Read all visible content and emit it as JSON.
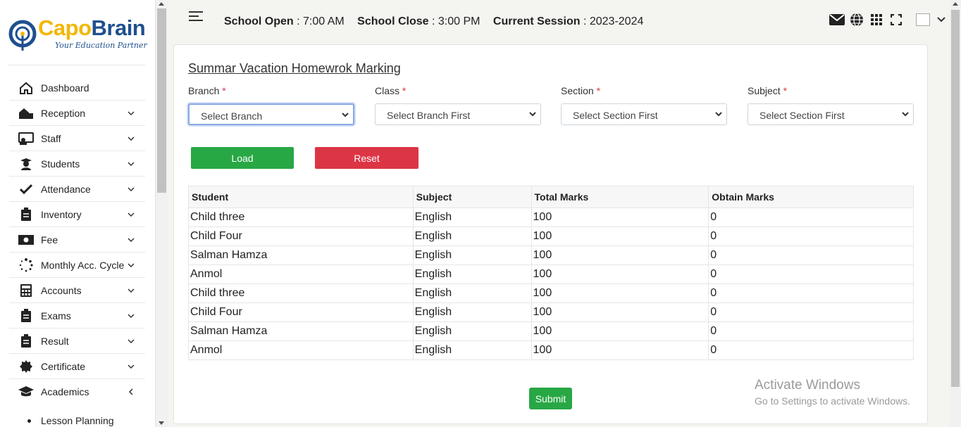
{
  "brand": {
    "name_part1": "Capo",
    "name_part2": "Brain",
    "tagline": "Your Education Partner"
  },
  "sidebar": {
    "items": [
      {
        "label": "Dashboard",
        "icon": "home-icon",
        "has_children": false
      },
      {
        "label": "Reception",
        "icon": "reception-icon",
        "has_children": true
      },
      {
        "label": "Staff",
        "icon": "staff-icon",
        "has_children": true
      },
      {
        "label": "Students",
        "icon": "student-icon",
        "has_children": true
      },
      {
        "label": "Attendance",
        "icon": "check-icon",
        "has_children": true
      },
      {
        "label": "Inventory",
        "icon": "clipboard-icon",
        "has_children": true
      },
      {
        "label": "Fee",
        "icon": "money-icon",
        "has_children": true
      },
      {
        "label": "Monthly Acc. Cycle",
        "icon": "spinner-icon",
        "has_children": true
      },
      {
        "label": "Accounts",
        "icon": "calculator-icon",
        "has_children": true
      },
      {
        "label": "Exams",
        "icon": "clipboard-icon",
        "has_children": true
      },
      {
        "label": "Result",
        "icon": "clipboard-icon",
        "has_children": true
      },
      {
        "label": "Certificate",
        "icon": "certificate-icon",
        "has_children": true
      },
      {
        "label": "Academics",
        "icon": "graduation-cap-icon",
        "has_children": true,
        "expanded": true
      }
    ],
    "sub_items": [
      {
        "label": "Lesson Planning"
      }
    ]
  },
  "header": {
    "open_label": "School Open",
    "open_value": "7:00 AM",
    "close_label": "School Close",
    "close_value": "3:00 PM",
    "session_label": "Current Session",
    "session_value": "2023-2024",
    "icons": [
      "envelope-icon",
      "globe-icon",
      "grid-icon",
      "fullscreen-icon"
    ]
  },
  "page": {
    "title": "Summar Vacation Homewrok Marking",
    "filters": [
      {
        "label": "Branch",
        "value": "Select Branch"
      },
      {
        "label": "Class",
        "value": "Select Branch First"
      },
      {
        "label": "Section",
        "value": "Select Section First"
      },
      {
        "label": "Subject",
        "value": "Select Section First"
      }
    ],
    "load_label": "Load",
    "reset_label": "Reset",
    "submit_label": "Submit",
    "table": {
      "headers": [
        "Student",
        "Subject",
        "Total Marks",
        "Obtain Marks"
      ],
      "rows": [
        [
          "Child three",
          "English",
          "100",
          "0"
        ],
        [
          "Child Four",
          "English",
          "100",
          "0"
        ],
        [
          "Salman Hamza",
          "English",
          "100",
          "0"
        ],
        [
          "Anmol",
          "English",
          "100",
          "0"
        ],
        [
          "Child three",
          "English",
          "100",
          "0"
        ],
        [
          "Child Four",
          "English",
          "100",
          "0"
        ],
        [
          "Salman Hamza",
          "English",
          "100",
          "0"
        ],
        [
          "Anmol",
          "English",
          "100",
          "0"
        ]
      ]
    }
  },
  "watermark": {
    "line1": "Activate Windows",
    "line2": "Go to Settings to activate Windows."
  },
  "colors": {
    "brand_yellow": "#f2b705",
    "brand_blue": "#1f4f8f",
    "success": "#28a745",
    "danger": "#dc3545"
  }
}
